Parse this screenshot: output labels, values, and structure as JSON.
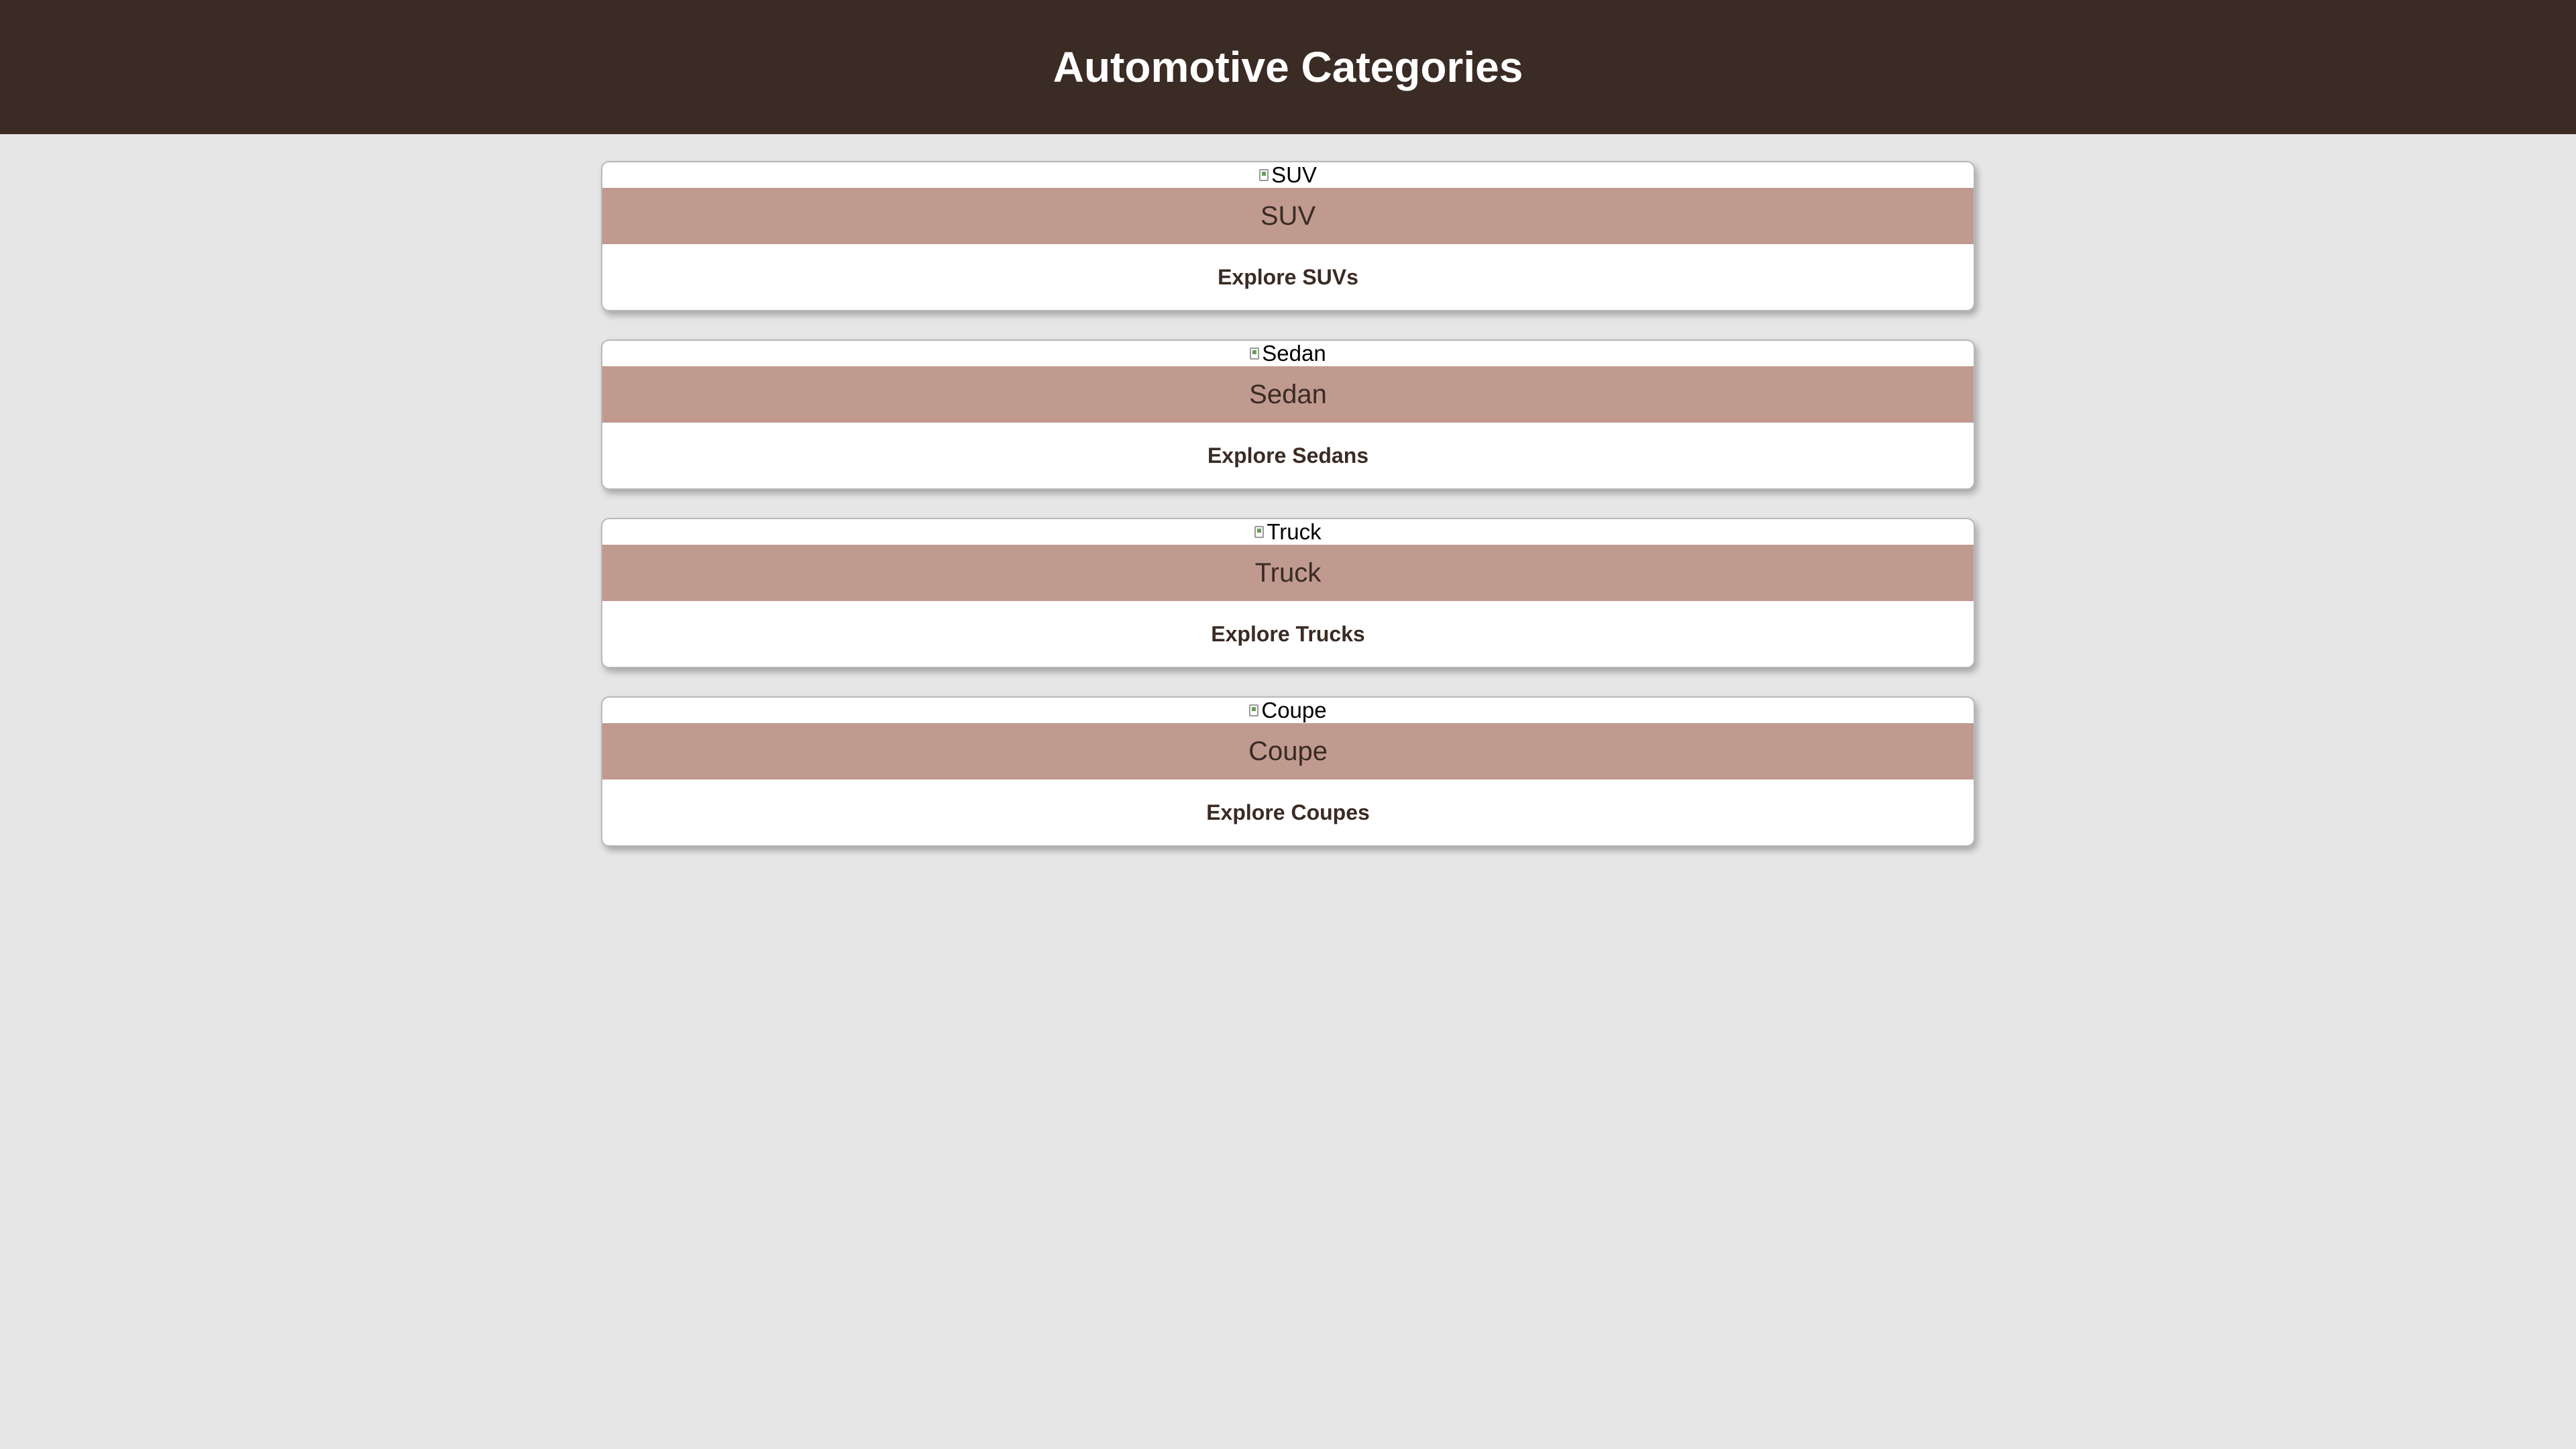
{
  "header": {
    "title": "Automotive Categories"
  },
  "colors": {
    "header_bg": "#3a2b24",
    "page_bg": "#e6e6e6",
    "card_title_bg": "#c09a8f",
    "card_bg": "#ffffff",
    "text_dark": "#3a2b24"
  },
  "categories": [
    {
      "image_alt": "SUV",
      "title": "SUV",
      "link": "Explore SUVs"
    },
    {
      "image_alt": "Sedan",
      "title": "Sedan",
      "link": "Explore Sedans"
    },
    {
      "image_alt": "Truck",
      "title": "Truck",
      "link": "Explore Trucks"
    },
    {
      "image_alt": "Coupe",
      "title": "Coupe",
      "link": "Explore Coupes"
    }
  ]
}
